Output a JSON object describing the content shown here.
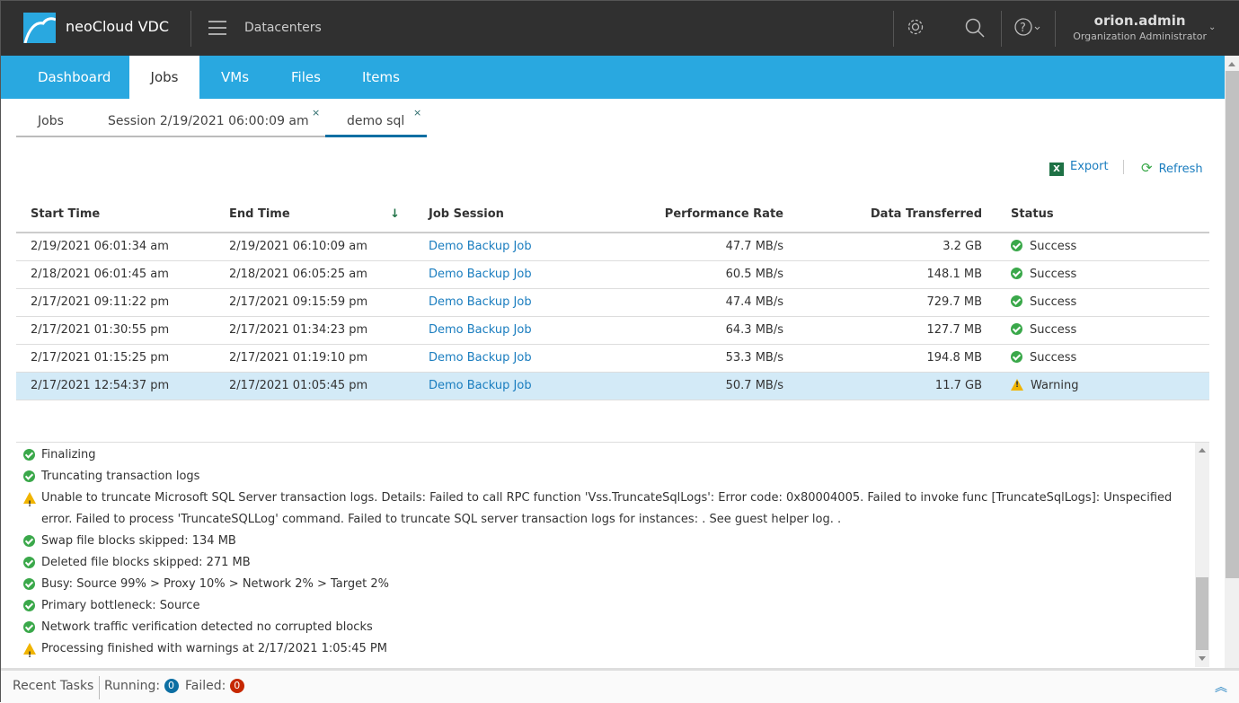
{
  "header": {
    "brand": "neoCloud VDC",
    "section": "Datacenters",
    "user": {
      "name": "orion.admin",
      "role": "Organization Administrator"
    }
  },
  "nav": {
    "tabs": [
      {
        "label": "Dashboard"
      },
      {
        "label": "Jobs",
        "active": true
      },
      {
        "label": "VMs"
      },
      {
        "label": "Files"
      },
      {
        "label": "Items"
      }
    ]
  },
  "subtabs": [
    {
      "label": "Jobs"
    },
    {
      "label": "Session 2/19/2021 06:00:09 am",
      "close": "×"
    },
    {
      "label": "demo sql",
      "close": "×",
      "active": true
    }
  ],
  "toolbar": {
    "export": "Export",
    "refresh": "Refresh"
  },
  "table": {
    "columns": [
      "Start Time",
      "End Time",
      "Job Session",
      "Performance Rate",
      "Data Transferred",
      "Status"
    ],
    "sort": "End Time descending",
    "rows": [
      {
        "start": "2/19/2021 06:01:34 am",
        "end": "2/19/2021 06:10:09 am",
        "job": "Demo Backup Job",
        "rate": "47.7 MB/s",
        "data": "3.2 GB",
        "status": "Success"
      },
      {
        "start": "2/18/2021 06:01:45 am",
        "end": "2/18/2021 06:05:25 am",
        "job": "Demo Backup Job",
        "rate": "60.5 MB/s",
        "data": "148.1 MB",
        "status": "Success"
      },
      {
        "start": "2/17/2021 09:11:22 pm",
        "end": "2/17/2021 09:15:59 pm",
        "job": "Demo Backup Job",
        "rate": "47.4 MB/s",
        "data": "729.7 MB",
        "status": "Success"
      },
      {
        "start": "2/17/2021 01:30:55 pm",
        "end": "2/17/2021 01:34:23 pm",
        "job": "Demo Backup Job",
        "rate": "64.3 MB/s",
        "data": "127.7 MB",
        "status": "Success"
      },
      {
        "start": "2/17/2021 01:15:25 pm",
        "end": "2/17/2021 01:19:10 pm",
        "job": "Demo Backup Job",
        "rate": "53.3 MB/s",
        "data": "194.8 MB",
        "status": "Success"
      },
      {
        "start": "2/17/2021 12:54:37 pm",
        "end": "2/17/2021 01:05:45 pm",
        "job": "Demo Backup Job",
        "rate": "50.7 MB/s",
        "data": "11.7 GB",
        "status": "Warning",
        "selected": true
      }
    ]
  },
  "log": [
    {
      "type": "success",
      "text": "Finalizing"
    },
    {
      "type": "success",
      "text": "Truncating transaction logs"
    },
    {
      "type": "warning",
      "text": "Unable to truncate Microsoft SQL Server transaction logs. Details: Failed to call RPC function 'Vss.TruncateSqlLogs': Error code: 0x80004005. Failed to invoke func [TruncateSqlLogs]: Unspecified error. Failed to process 'TruncateSQLLog' command. Failed to truncate SQL server transaction logs for instances: . See guest helper log. ."
    },
    {
      "type": "success",
      "text": "Swap file blocks skipped: 134 MB"
    },
    {
      "type": "success",
      "text": "Deleted file blocks skipped: 271 MB"
    },
    {
      "type": "success",
      "text": "Busy: Source 99% > Proxy 10% > Network 2% > Target 2%"
    },
    {
      "type": "success",
      "text": "Primary bottleneck: Source"
    },
    {
      "type": "success",
      "text": "Network traffic verification detected no corrupted blocks"
    },
    {
      "type": "warning",
      "text": "Processing finished with warnings at 2/17/2021 1:05:45 PM"
    }
  ],
  "footer": {
    "recent": "Recent Tasks",
    "running_label": "Running:",
    "running": "0",
    "failed_label": "Failed:",
    "failed": "0"
  },
  "colors": {
    "header": "#303030",
    "accent": "#29a8e0",
    "link": "#1a7dbf",
    "success": "#3aa84a",
    "warning": "#f0b400",
    "selected": "#d3eaf7"
  }
}
